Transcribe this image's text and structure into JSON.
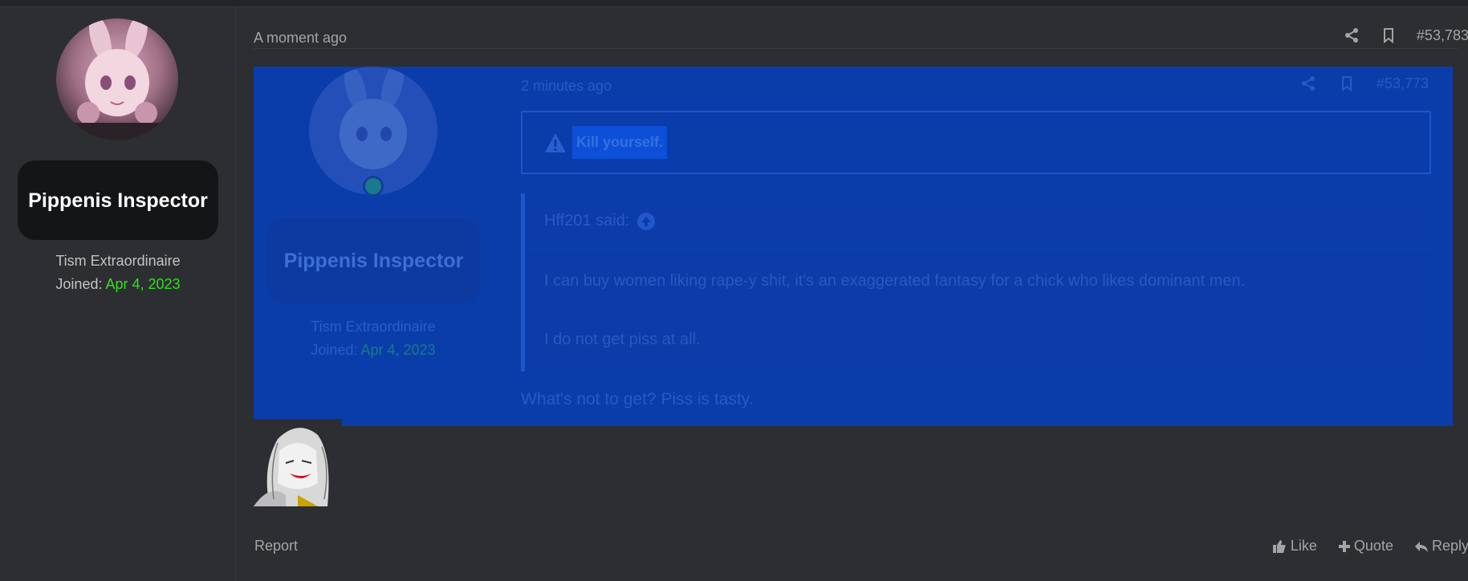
{
  "poster": {
    "name": "Pippenis Inspector",
    "user_title": "Tism Extraordinaire",
    "joined_label": "Joined:",
    "joined_date": "Apr 4, 2023"
  },
  "post": {
    "time": "A moment ago",
    "number": "#53,783",
    "reply_text": "What's not to get? Piss is tasty."
  },
  "quoted_post": {
    "name": "Pippenis Inspector",
    "user_title": "Tism Extraordinaire",
    "joined_label": "Joined:",
    "joined_date": "Apr 4, 2023",
    "time": "2 minutes ago",
    "number": "#53,773",
    "warning": "Kill yourself.",
    "blockquote": {
      "author": "Hff201 said:",
      "line1": "I can buy women liking rape-y shit, it's an exaggerated fantasy for a chick who likes dominant men.",
      "line2": "I do not get piss at all."
    }
  },
  "footer": {
    "report": "Report",
    "like": "Like",
    "quote": "Quote",
    "reply": "Reply"
  },
  "colors": {
    "background": "#2c2e31",
    "selection": "#0b3daa",
    "joined_date": "#32e01e"
  },
  "icons": [
    "share-icon",
    "bookmark-icon",
    "warning-icon",
    "arrow-up-icon",
    "thumbs-up-icon",
    "plus-icon",
    "reply-icon"
  ]
}
